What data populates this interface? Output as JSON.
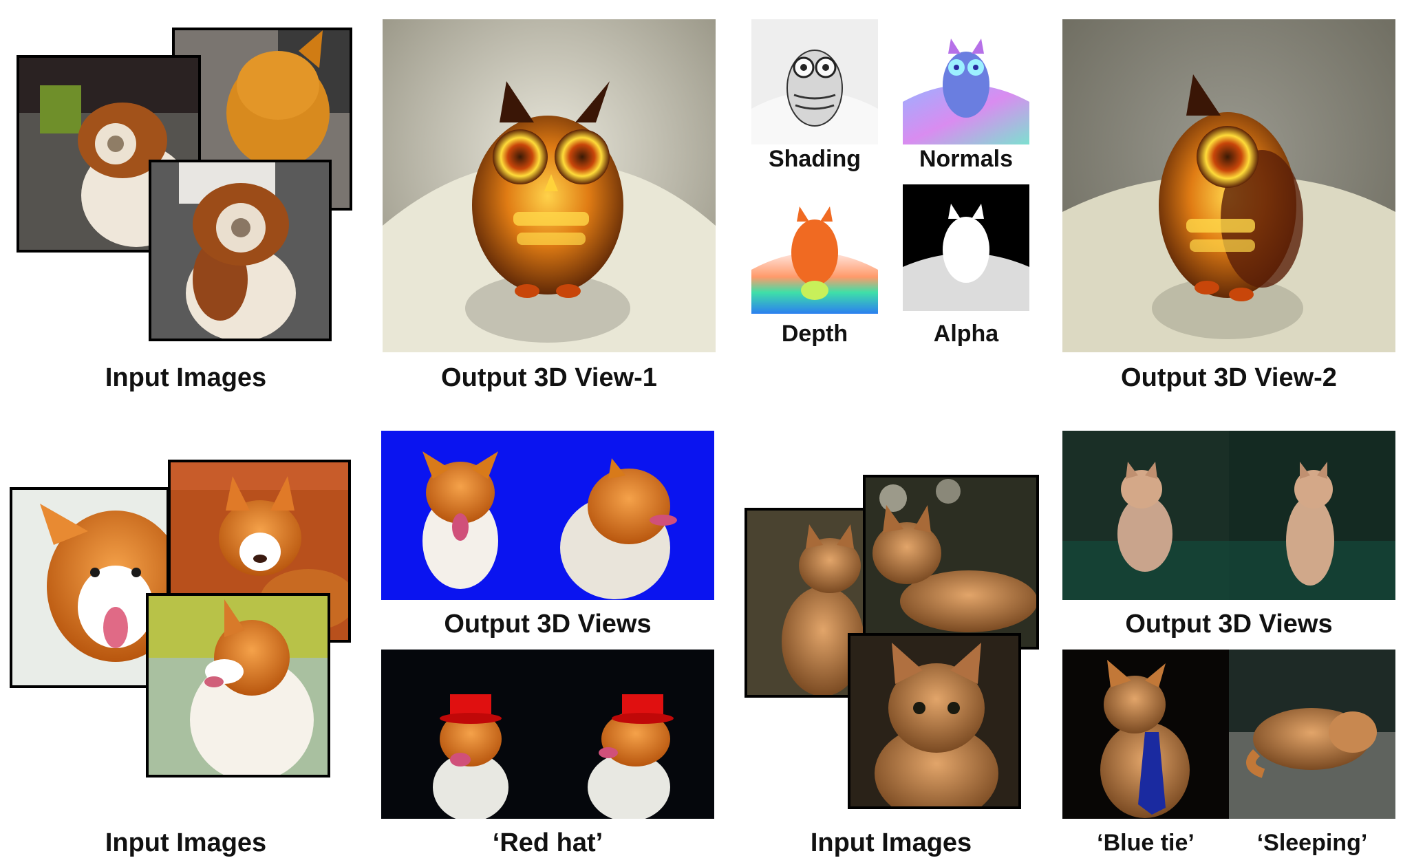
{
  "top": {
    "input_label": "Input Images",
    "view1_label": "Output 3D View-1",
    "view2_label": "Output 3D View-2",
    "passes": {
      "shading": "Shading",
      "normals": "Normals",
      "depth": "Depth",
      "alpha": "Alpha"
    }
  },
  "bottom_left": {
    "views_label": "Output 3D Views",
    "edit_label": "‘Red hat’",
    "input_label": "Input Images"
  },
  "bottom_right": {
    "input_label": "Input Images",
    "views_label": "Output 3D Views",
    "edit1_label": "‘Blue tie’",
    "edit2_label": "‘Sleeping’"
  },
  "colors": {
    "dog_background": "#0a14f0",
    "owl_body": "#b4520a",
    "cat_fur": "#b77a45"
  }
}
